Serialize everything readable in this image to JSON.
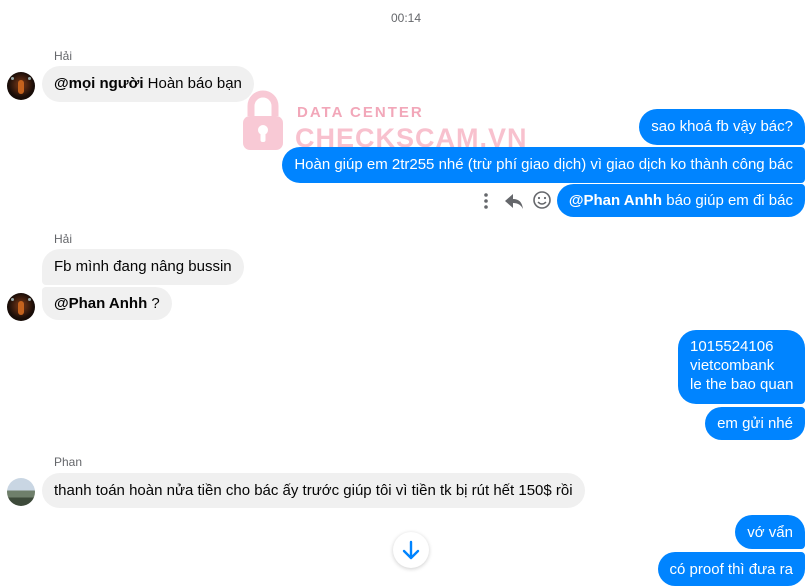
{
  "timestamp": "00:14",
  "watermark": {
    "line1": "DATA CENTER",
    "line2": "CHECKSCAM.VN"
  },
  "messages": [
    {
      "sender": "Hải",
      "mention": "@mọi người",
      "text": "Hoàn báo bạn"
    },
    {
      "text": "sao khoá fb vậy bác?"
    },
    {
      "text": "Hoàn giúp em 2tr255 nhé (trừ phí giao dịch) vì giao dịch ko thành công bác"
    },
    {
      "mention": "@Phan Anhh",
      "text": "báo giúp em đi bác"
    },
    {
      "sender": "Hải",
      "text": "Fb mình đang nâng bussin"
    },
    {
      "mention": "@Phan Anhh",
      "text": "?"
    },
    {
      "line1": "1015524106",
      "line2": "vietcombank",
      "line3": "le the bao quan"
    },
    {
      "text": "em gửi nhé"
    },
    {
      "sender": "Phan",
      "text": "thanh toán hoàn nửa tiền cho bác ấy trước giúp tôi vì tiền tk bị rút hết 150$ rồi"
    },
    {
      "text": "vớ vẩn"
    },
    {
      "text": "có proof thì đưa ra"
    }
  ],
  "icons": {
    "more": "more-vertical-icon",
    "reply": "reply-icon",
    "react": "smiley-icon",
    "scroll": "arrow-down-icon"
  },
  "colors": {
    "outgoing": "#0084ff",
    "incoming": "#f0f0f0",
    "watermark": "#f7b7c6"
  }
}
